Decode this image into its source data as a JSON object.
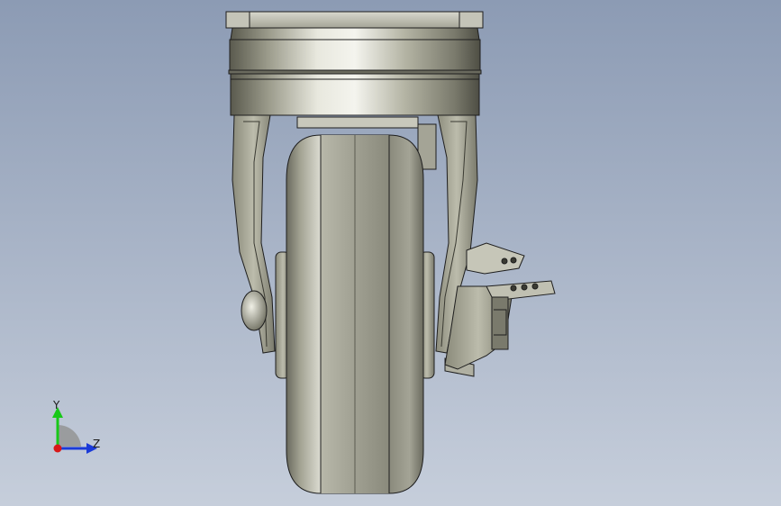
{
  "viewport": {
    "background_top": "#8c9bb4",
    "background_bottom": "#c6cedb"
  },
  "model": {
    "metal_color": "#a8a896",
    "edge_color": "#1e1e1e",
    "highlight_color": "#f2f2ea",
    "shadow_color": "#55554a"
  },
  "triad": {
    "y_label": "Y",
    "z_label": "Z",
    "y_color": "#18c818",
    "z_color": "#1a3ad8",
    "x_color": "#d81818"
  }
}
